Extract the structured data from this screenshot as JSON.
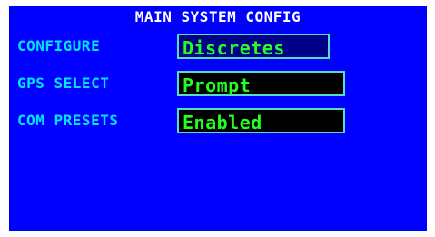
{
  "title": "MAIN SYSTEM CONFIG",
  "rows": [
    {
      "label": "CONFIGURE",
      "value": "Discretes"
    },
    {
      "label": "GPS SELECT",
      "value": "Prompt"
    },
    {
      "label": "COM PRESETS",
      "value": "Enabled"
    }
  ],
  "colors": {
    "screen_background": "#0000ff",
    "title_text": "#ffffff",
    "label_text": "#00e5ff",
    "field_border": "#55ddcc",
    "field_text": "#22ff22",
    "field_background": "#000000",
    "selected_field_background": "#000088"
  }
}
